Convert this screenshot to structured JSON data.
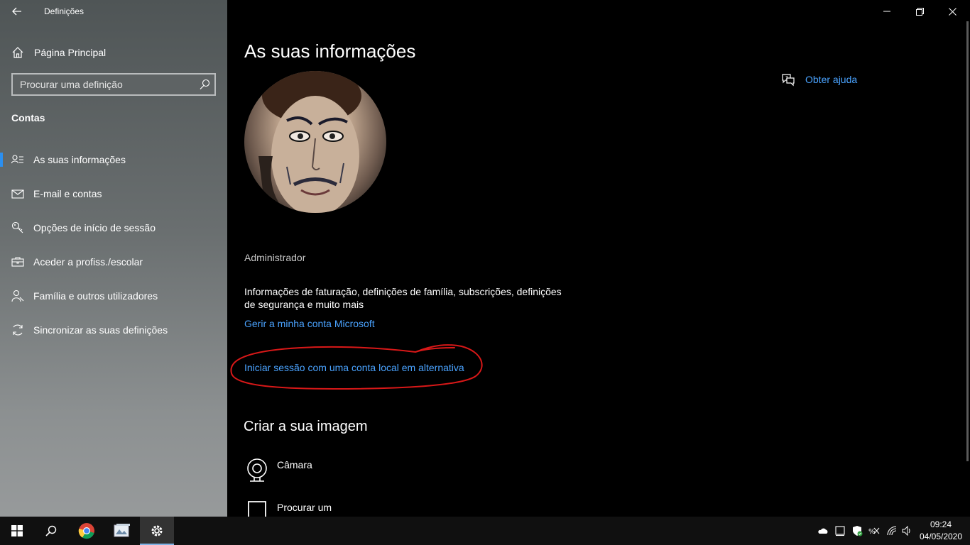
{
  "window": {
    "title": "Definições"
  },
  "sidebar": {
    "home_label": "Página Principal",
    "search_placeholder": "Procurar uma definição",
    "section": "Contas",
    "items": [
      {
        "label": "As suas informações",
        "icon": "person-info-icon",
        "active": true
      },
      {
        "label": "E-mail e contas",
        "icon": "mail-icon",
        "active": false
      },
      {
        "label": "Opções de início de sessão",
        "icon": "key-icon",
        "active": false
      },
      {
        "label": "Aceder a profiss./escolar",
        "icon": "briefcase-icon",
        "active": false
      },
      {
        "label": "Família e outros utilizadores",
        "icon": "people-icon",
        "active": false
      },
      {
        "label": "Sincronizar as suas definições",
        "icon": "sync-icon",
        "active": false
      }
    ]
  },
  "main": {
    "title": "As suas informações",
    "help_label": "Obter ajuda",
    "account_type": "Administrador",
    "info_text": "Informações de faturação, definições de família, subscrições, definições de segurança e muito mais",
    "manage_link": "Gerir a minha conta Microsoft",
    "local_link": "Iniciar sessão com uma conta local em alternativa",
    "create_title": "Criar a sua imagem",
    "options": [
      {
        "label": "Câmara",
        "icon": "camera-icon"
      },
      {
        "label": "Procurar um",
        "icon": "browse-icon"
      }
    ]
  },
  "taskbar": {
    "time": "09:24",
    "date": "04/05/2020"
  },
  "colors": {
    "accent": "#2b8ff0",
    "link": "#4aa3ff",
    "annotation": "#d81818"
  }
}
